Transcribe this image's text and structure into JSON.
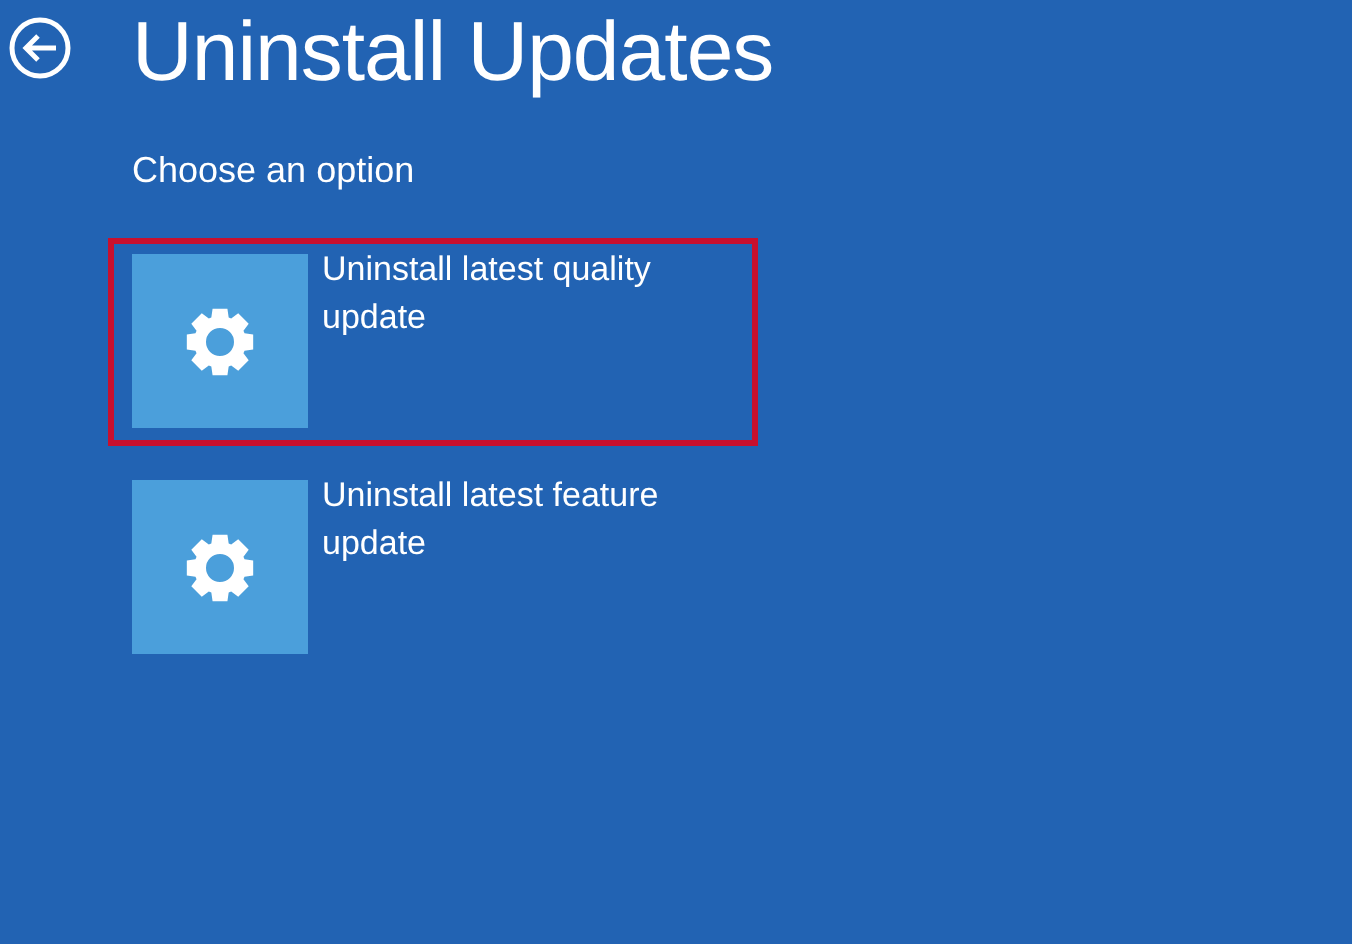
{
  "page": {
    "title": "Uninstall Updates",
    "subtitle": "Choose an option"
  },
  "options": [
    {
      "label": "Uninstall latest quality update",
      "highlighted": true
    },
    {
      "label": "Uninstall latest feature update",
      "highlighted": false
    }
  ]
}
